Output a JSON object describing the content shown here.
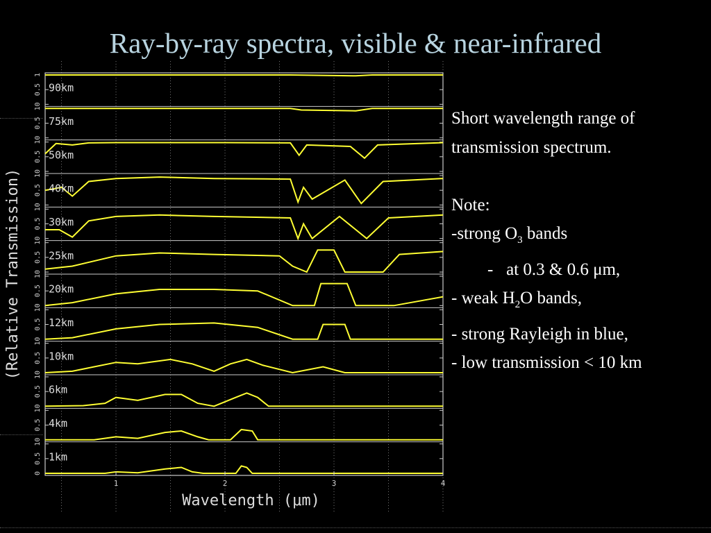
{
  "slide": {
    "title": "Ray-by-ray spectra, visible & near-infrared"
  },
  "notes": {
    "line1": "Short wavelength range of",
    "line2": "transmission spectrum.",
    "note_label": "Note:",
    "o3_prefix": "-strong O",
    "o3_sub": "3",
    "o3_suffix": " bands",
    "o3_dash": "-",
    "o3_detail": "at 0.3 & 0.6 μm,",
    "h2o_prefix": "- weak H",
    "h2o_sub": "2",
    "h2o_suffix": "O bands,",
    "rayleigh": "- strong Rayleigh in blue,",
    "low": "- low transmission < 10 km"
  },
  "chart_data": {
    "type": "line",
    "xlabel": "Wavelength (μm)",
    "ylabel": "(Relative Transmission)",
    "xlim": [
      0.35,
      4.0
    ],
    "xticks": [
      1,
      2,
      3,
      4
    ],
    "ylim_per_panel": [
      0,
      1
    ],
    "panel_yticks": [
      "0",
      "0.5",
      "1"
    ],
    "grid": true,
    "color": "#ffff33",
    "panels": [
      {
        "label": "90km",
        "x": [
          0.35,
          1.0,
          2.0,
          2.6,
          3.2,
          3.35,
          4.0
        ],
        "y": [
          1.0,
          1.0,
          1.0,
          1.0,
          0.97,
          1.0,
          1.0
        ]
      },
      {
        "label": "75km",
        "x": [
          0.35,
          1.0,
          2.0,
          2.6,
          2.7,
          3.2,
          3.35,
          4.0
        ],
        "y": [
          1.0,
          1.0,
          1.0,
          1.0,
          0.95,
          0.92,
          1.0,
          1.0
        ]
      },
      {
        "label": "50km",
        "x": [
          0.35,
          0.45,
          0.6,
          0.75,
          1.0,
          2.0,
          2.6,
          2.68,
          2.75,
          3.15,
          3.28,
          3.4,
          4.0
        ],
        "y": [
          0.6,
          0.95,
          0.9,
          0.97,
          0.98,
          0.98,
          0.97,
          0.55,
          0.9,
          0.85,
          0.45,
          0.9,
          0.98
        ]
      },
      {
        "label": "40km",
        "x": [
          0.35,
          0.5,
          0.6,
          0.75,
          1.0,
          1.4,
          1.9,
          2.6,
          2.67,
          2.72,
          2.8,
          3.1,
          3.25,
          3.45,
          4.0
        ],
        "y": [
          0.5,
          0.6,
          0.3,
          0.8,
          0.9,
          0.95,
          0.9,
          0.88,
          0.1,
          0.6,
          0.2,
          0.85,
          0.05,
          0.8,
          0.9
        ]
      },
      {
        "label": "30km",
        "x": [
          0.35,
          0.48,
          0.6,
          0.75,
          1.0,
          1.4,
          1.9,
          2.6,
          2.67,
          2.72,
          2.8,
          3.05,
          3.3,
          3.5,
          4.0
        ],
        "y": [
          0.3,
          0.3,
          0.05,
          0.6,
          0.75,
          0.8,
          0.75,
          0.7,
          0.0,
          0.5,
          0.0,
          0.75,
          0.0,
          0.7,
          0.8
        ]
      },
      {
        "label": "25km",
        "x": [
          0.35,
          0.6,
          1.0,
          1.4,
          1.9,
          2.5,
          2.62,
          2.75,
          2.85,
          3.0,
          3.1,
          3.45,
          3.6,
          4.0
        ],
        "y": [
          0.1,
          0.2,
          0.55,
          0.65,
          0.6,
          0.55,
          0.2,
          0.0,
          0.75,
          0.75,
          0.0,
          0.0,
          0.6,
          0.7
        ]
      },
      {
        "label": "20km",
        "x": [
          0.35,
          0.6,
          1.0,
          1.4,
          1.9,
          2.3,
          2.62,
          2.82,
          2.88,
          3.12,
          3.2,
          3.55,
          4.0
        ],
        "y": [
          0.0,
          0.1,
          0.4,
          0.55,
          0.55,
          0.5,
          0.0,
          0.0,
          0.75,
          0.75,
          0.0,
          0.0,
          0.3
        ]
      },
      {
        "label": "12km",
        "x": [
          0.35,
          0.6,
          1.0,
          1.4,
          1.9,
          2.3,
          2.62,
          2.85,
          2.9,
          3.1,
          3.15,
          4.0
        ],
        "y": [
          0.0,
          0.05,
          0.35,
          0.5,
          0.55,
          0.4,
          0.0,
          0.0,
          0.5,
          0.5,
          0.0,
          0.0
        ]
      },
      {
        "label": "10km",
        "x": [
          0.35,
          0.6,
          0.8,
          1.0,
          1.2,
          1.5,
          1.7,
          1.9,
          2.05,
          2.2,
          2.35,
          2.62,
          2.9,
          3.1,
          4.0
        ],
        "y": [
          0.0,
          0.05,
          0.2,
          0.35,
          0.3,
          0.45,
          0.3,
          0.05,
          0.3,
          0.45,
          0.25,
          0.0,
          0.2,
          0.0,
          0.0
        ]
      },
      {
        "label": "6km",
        "x": [
          0.35,
          0.7,
          0.9,
          1.0,
          1.2,
          1.45,
          1.6,
          1.75,
          1.9,
          2.1,
          2.2,
          2.3,
          2.4,
          4.0
        ],
        "y": [
          0.0,
          0.02,
          0.1,
          0.3,
          0.2,
          0.4,
          0.4,
          0.1,
          0.0,
          0.3,
          0.45,
          0.3,
          0.0,
          0.0
        ]
      },
      {
        "label": "4km",
        "x": [
          0.35,
          0.8,
          1.0,
          1.2,
          1.45,
          1.6,
          1.75,
          1.85,
          2.05,
          2.15,
          2.25,
          2.3,
          4.0
        ],
        "y": [
          0.0,
          0.0,
          0.1,
          0.05,
          0.25,
          0.3,
          0.1,
          0.0,
          0.0,
          0.35,
          0.3,
          0.0,
          0.0
        ]
      },
      {
        "label": "1km",
        "x": [
          0.35,
          0.9,
          1.0,
          1.2,
          1.45,
          1.6,
          1.7,
          1.8,
          2.1,
          2.15,
          2.2,
          2.25,
          4.0
        ],
        "y": [
          0.0,
          0.0,
          0.05,
          0.02,
          0.15,
          0.2,
          0.05,
          0.0,
          0.0,
          0.25,
          0.2,
          0.0,
          0.0
        ]
      }
    ]
  }
}
